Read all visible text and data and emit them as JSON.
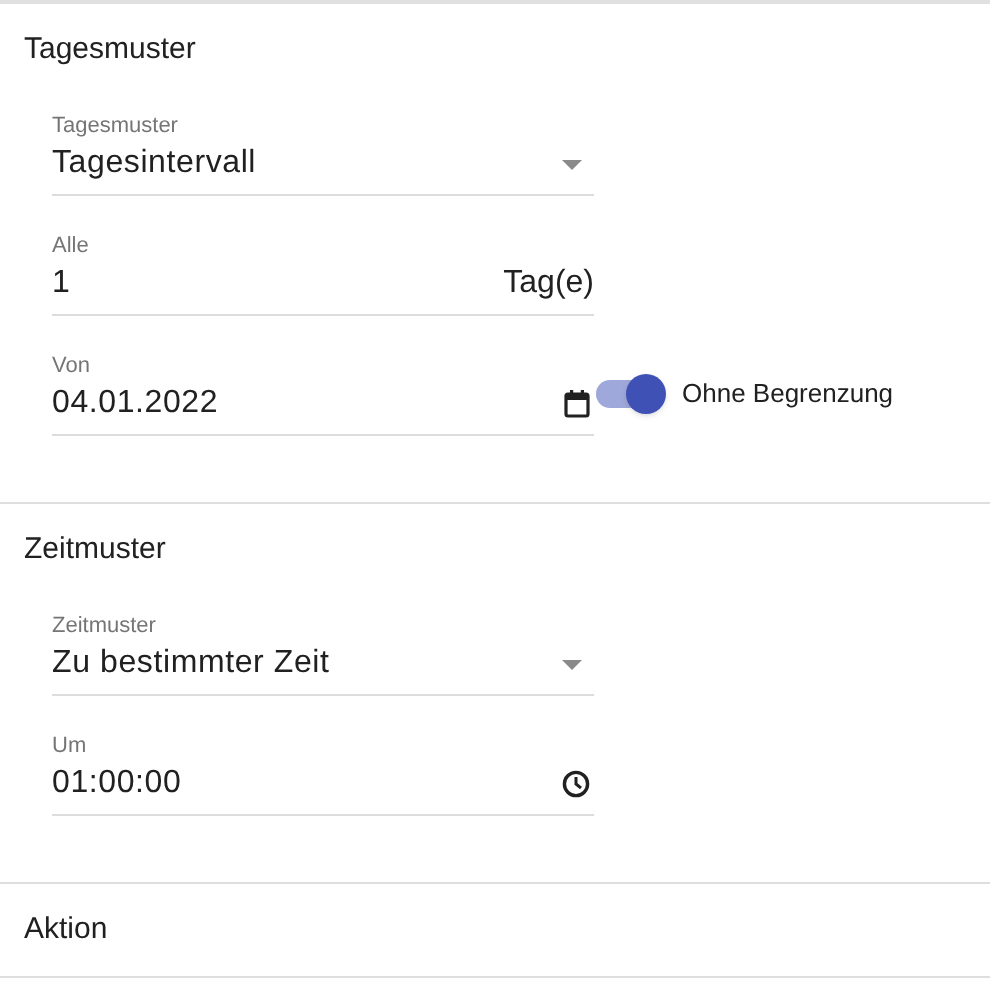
{
  "sections": [
    {
      "title": "Tagesmuster",
      "fields": [
        {
          "kind": "select",
          "label": "Tagesmuster",
          "value": "Tagesintervall"
        },
        {
          "kind": "text",
          "label": "Alle",
          "value": "1",
          "suffix": "Tag(e)"
        },
        {
          "kind": "date",
          "label": "Von",
          "value": "04.01.2022",
          "toggle": {
            "label": "Ohne Begrenzung",
            "on": true
          }
        }
      ]
    },
    {
      "title": "Zeitmuster",
      "fields": [
        {
          "kind": "select",
          "label": "Zeitmuster",
          "value": "Zu bestimmter Zeit"
        },
        {
          "kind": "time",
          "label": "Um",
          "value": "01:00:00"
        }
      ]
    },
    {
      "title": "Aktion"
    }
  ]
}
